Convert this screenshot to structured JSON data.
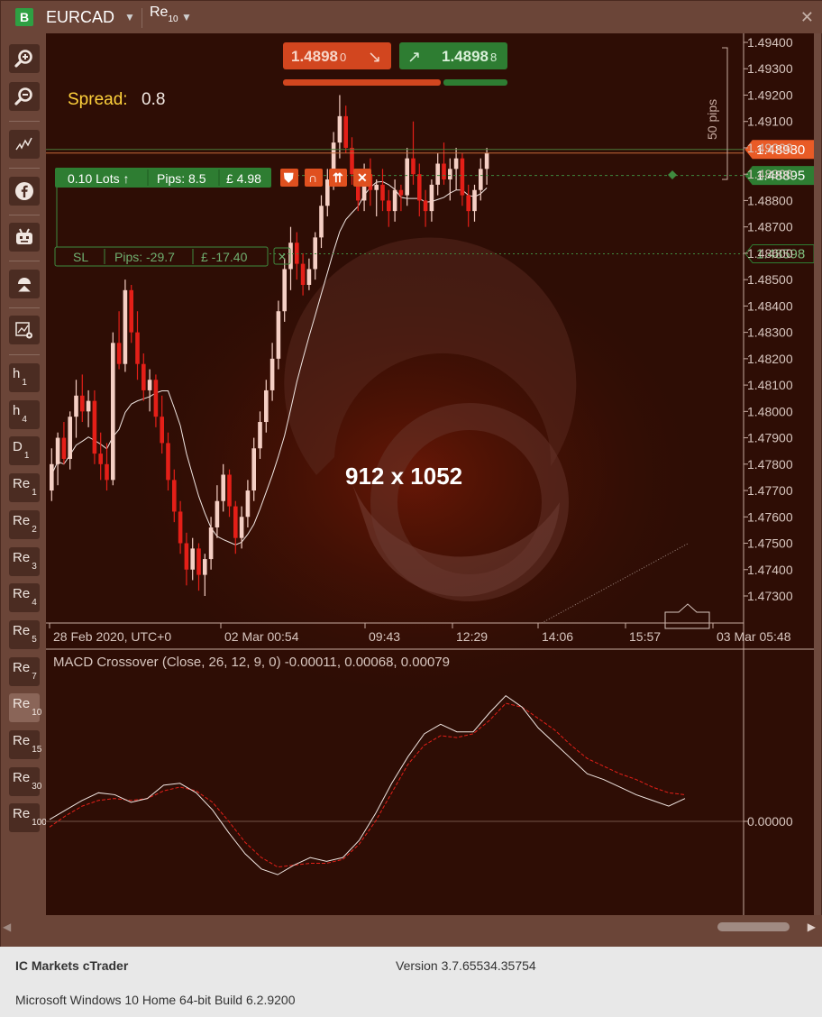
{
  "header": {
    "badge": "B",
    "symbol": "EURCAD",
    "timeframe": "Re",
    "timeframe_sub": "10",
    "close": "✕"
  },
  "sidebar": {
    "tools": [
      "zoom-in",
      "zoom-out",
      "chart-type",
      "facebook",
      "bot",
      "objects",
      "settings"
    ],
    "timeframes": [
      {
        "label": "h",
        "sub": "1"
      },
      {
        "label": "h",
        "sub": "4"
      },
      {
        "label": "D",
        "sub": "1"
      },
      {
        "label": "Re",
        "sub": "1"
      },
      {
        "label": "Re",
        "sub": "2"
      },
      {
        "label": "Re",
        "sub": "3"
      },
      {
        "label": "Re",
        "sub": "4"
      },
      {
        "label": "Re",
        "sub": "5"
      },
      {
        "label": "Re",
        "sub": "7"
      },
      {
        "label": "Re",
        "sub": "10"
      },
      {
        "label": "Re",
        "sub": "15"
      },
      {
        "label": "Re",
        "sub": "30"
      },
      {
        "label": "Re",
        "sub": "100"
      }
    ],
    "active_timeframe": "Re10"
  },
  "trade": {
    "sell_price": "1.4898",
    "sell_pip": "0",
    "buy_price": "1.4898",
    "buy_pip": "8",
    "spread_label": "Spread:",
    "spread_value": "0.8",
    "position_lots": "0.10 Lots",
    "position_pips": "Pips: 8.5",
    "position_pnl": "£ 4.98",
    "sl_label": "SL",
    "sl_pips": "Pips: -29.7",
    "sl_pnl": "£ -17.40",
    "pips_ruler": "50 pips"
  },
  "chart": {
    "overlay_text": "912 x 1052",
    "current_price_tag": "1.48980",
    "position_price_tag": "1.48895",
    "sl_price_tag": "1.48598",
    "price_ticks": [
      "1.4940",
      "1.4930",
      "1.4920",
      "1.4910",
      "1.4900",
      "1.4890",
      "1.4880",
      "1.4870",
      "1.4860",
      "1.4850",
      "1.4840",
      "1.4830",
      "1.4820",
      "1.4810",
      "1.4800",
      "1.4790",
      "1.4780",
      "1.4770",
      "1.4760",
      "1.4750",
      "1.4740",
      "1.4730"
    ],
    "tick_suffix": "0",
    "time_ticks": [
      "28 Feb 2020, UTC+0",
      "02 Mar 00:54",
      "09:43",
      "12:29",
      "14:06",
      "15:57",
      "03 Mar 05:48"
    ],
    "macd_title": "MACD Crossover (Close, 26, 12, 9, 0) -0.00011, 0.00068, 0.00079",
    "macd_zero_tick": "0.00000",
    "colors": {
      "bull": "#f5cfc4",
      "bear": "#e41f18",
      "background": "#2e0d05",
      "sell": "#d2461f",
      "buy": "#2e7d32",
      "spread": "#ffd23c"
    }
  },
  "candles": [
    [
      1.477,
      1.4786,
      1.4766,
      1.478
    ],
    [
      1.478,
      1.4792,
      1.4772,
      1.479
    ],
    [
      1.479,
      1.4796,
      1.478,
      1.4782
    ],
    [
      1.4782,
      1.48,
      1.4778,
      1.4798
    ],
    [
      1.4798,
      1.4812,
      1.479,
      1.4806
    ],
    [
      1.4806,
      1.4814,
      1.4796,
      1.48
    ],
    [
      1.48,
      1.4808,
      1.4794,
      1.4804
    ],
    [
      1.4804,
      1.4808,
      1.478,
      1.4784
    ],
    [
      1.4784,
      1.4792,
      1.4774,
      1.478
    ],
    [
      1.478,
      1.4788,
      1.477,
      1.4774
    ],
    [
      1.4774,
      1.483,
      1.4772,
      1.4826
    ],
    [
      1.4826,
      1.4838,
      1.4816,
      1.4818
    ],
    [
      1.4818,
      1.485,
      1.4815,
      1.4846
    ],
    [
      1.4846,
      1.4848,
      1.4826,
      1.483
    ],
    [
      1.483,
      1.4838,
      1.4812,
      1.4818
    ],
    [
      1.4818,
      1.4822,
      1.4804,
      1.4808
    ],
    [
      1.4808,
      1.4816,
      1.48,
      1.4812
    ],
    [
      1.4812,
      1.4814,
      1.4794,
      1.4798
    ],
    [
      1.4798,
      1.4806,
      1.4784,
      1.4788
    ],
    [
      1.4788,
      1.4792,
      1.477,
      1.4774
    ],
    [
      1.4774,
      1.4778,
      1.4758,
      1.4762
    ],
    [
      1.4762,
      1.4766,
      1.4746,
      1.475
    ],
    [
      1.475,
      1.4754,
      1.4734,
      1.474
    ],
    [
      1.474,
      1.4752,
      1.4736,
      1.4748
    ],
    [
      1.4748,
      1.475,
      1.4732,
      1.4738
    ],
    [
      1.4738,
      1.4746,
      1.473,
      1.4744
    ],
    [
      1.4744,
      1.476,
      1.474,
      1.4756
    ],
    [
      1.4756,
      1.4772,
      1.4752,
      1.4766
    ],
    [
      1.4766,
      1.478,
      1.4762,
      1.4776
    ],
    [
      1.4776,
      1.4778,
      1.476,
      1.4764
    ],
    [
      1.4764,
      1.4766,
      1.4746,
      1.4752
    ],
    [
      1.4752,
      1.4764,
      1.4748,
      1.476
    ],
    [
      1.476,
      1.4774,
      1.4756,
      1.477
    ],
    [
      1.477,
      1.479,
      1.4766,
      1.4786
    ],
    [
      1.4786,
      1.48,
      1.4782,
      1.4796
    ],
    [
      1.4796,
      1.4812,
      1.4792,
      1.4808
    ],
    [
      1.4808,
      1.4826,
      1.4804,
      1.482
    ],
    [
      1.482,
      1.4842,
      1.4816,
      1.4838
    ],
    [
      1.4838,
      1.4858,
      1.4834,
      1.4854
    ],
    [
      1.4854,
      1.487,
      1.4846,
      1.4864
    ],
    [
      1.4864,
      1.4868,
      1.485,
      1.4856
    ],
    [
      1.4856,
      1.486,
      1.4844,
      1.4848
    ],
    [
      1.4848,
      1.4858,
      1.4846,
      1.4854
    ],
    [
      1.4854,
      1.4868,
      1.485,
      1.4866
    ],
    [
      1.4866,
      1.4882,
      1.4862,
      1.4878
    ],
    [
      1.4878,
      1.4892,
      1.4874,
      1.4888
    ],
    [
      1.4888,
      1.4906,
      1.4884,
      1.4902
    ],
    [
      1.4902,
      1.492,
      1.4896,
      1.4912
    ],
    [
      1.4912,
      1.4916,
      1.4898,
      1.49
    ],
    [
      1.49,
      1.4904,
      1.4886,
      1.489
    ],
    [
      1.489,
      1.4892,
      1.4876,
      1.488
    ],
    [
      1.488,
      1.4894,
      1.4876,
      1.489
    ],
    [
      1.489,
      1.4896,
      1.4878,
      1.4884
    ],
    [
      1.4884,
      1.4888,
      1.4874,
      1.4886
    ],
    [
      1.4886,
      1.4892,
      1.4876,
      1.488
    ],
    [
      1.488,
      1.4884,
      1.487,
      1.4876
    ],
    [
      1.4876,
      1.4888,
      1.4872,
      1.4884
    ],
    [
      1.4884,
      1.4886,
      1.4876,
      1.4882
    ],
    [
      1.4882,
      1.49,
      1.4878,
      1.4896
    ],
    [
      1.4896,
      1.491,
      1.4886,
      1.489
    ],
    [
      1.489,
      1.4894,
      1.4874,
      1.488
    ],
    [
      1.488,
      1.4884,
      1.487,
      1.4876
    ],
    [
      1.4876,
      1.4888,
      1.4872,
      1.4886
    ],
    [
      1.4886,
      1.4898,
      1.4882,
      1.4894
    ],
    [
      1.4894,
      1.4902,
      1.4886,
      1.4888
    ],
    [
      1.4888,
      1.4896,
      1.488,
      1.4892
    ],
    [
      1.4892,
      1.49,
      1.4884,
      1.4896
    ],
    [
      1.4896,
      1.4898,
      1.4878,
      1.4882
    ],
    [
      1.4882,
      1.4886,
      1.487,
      1.4876
    ],
    [
      1.4876,
      1.4886,
      1.4872,
      1.4884
    ],
    [
      1.4884,
      1.4896,
      1.488,
      1.4892
    ],
    [
      1.4892,
      1.49,
      1.4886,
      1.4898
    ]
  ],
  "macd": {
    "line": [
      5e-05,
      0.0003,
      0.00055,
      0.00075,
      0.0007,
      0.0005,
      0.0006,
      0.00095,
      0.001,
      0.00075,
      0.0003,
      -0.0003,
      -0.00085,
      -0.00125,
      -0.0014,
      -0.00115,
      -0.00095,
      -0.00105,
      -0.00095,
      -0.0005,
      0.0002,
      0.001,
      0.0017,
      0.0023,
      0.00255,
      0.00235,
      0.00235,
      0.00285,
      0.0033,
      0.003,
      0.00245,
      0.00205,
      0.00165,
      0.00125,
      0.0011,
      0.0009,
      0.0007,
      0.00055,
      0.0004,
      0.0006
    ],
    "signal": [
      -0.00015,
      0.00015,
      0.0004,
      0.00055,
      0.0006,
      0.00055,
      0.0006,
      0.0008,
      0.0009,
      0.0008,
      0.0005,
      0.0,
      -0.00055,
      -0.00095,
      -0.0012,
      -0.00115,
      -0.0011,
      -0.0011,
      -0.001,
      -0.0006,
      0.0,
      0.00075,
      0.0015,
      0.002,
      0.00225,
      0.0022,
      0.0023,
      0.00265,
      0.0031,
      0.003,
      0.0027,
      0.0024,
      0.002,
      0.00165,
      0.00145,
      0.00125,
      0.0011,
      0.0009,
      0.00075,
      0.0007
    ]
  },
  "footer": {
    "app": "IC Markets cTrader",
    "version": "Version 3.7.65534.35754",
    "os": "Microsoft Windows 10 Home 64-bit Build 6.2.9200"
  }
}
